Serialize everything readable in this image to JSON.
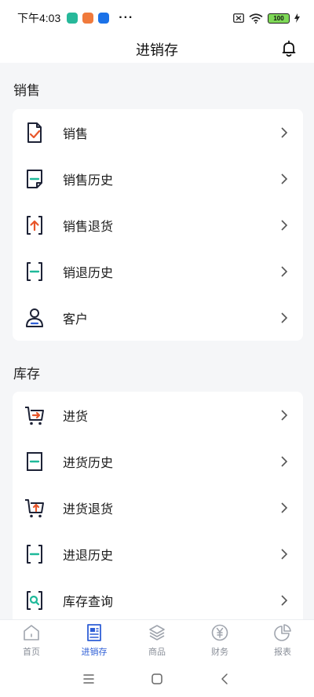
{
  "status": {
    "time": "下午4:03",
    "more": "···",
    "battery": "100"
  },
  "header": {
    "title": "进销存"
  },
  "sections": [
    {
      "title": "销售",
      "items": [
        {
          "label": "销售",
          "icon": "check-document-icon"
        },
        {
          "label": "销售历史",
          "icon": "document-history-icon"
        },
        {
          "label": "销售退货",
          "icon": "return-up-icon"
        },
        {
          "label": "销退历史",
          "icon": "bracket-history-icon"
        },
        {
          "label": "客户",
          "icon": "customer-icon"
        }
      ]
    },
    {
      "title": "库存",
      "items": [
        {
          "label": "进货",
          "icon": "cart-arrow-icon"
        },
        {
          "label": "进货历史",
          "icon": "document-history-icon"
        },
        {
          "label": "进货退货",
          "icon": "cart-return-icon"
        },
        {
          "label": "进退历史",
          "icon": "bracket-history-icon"
        },
        {
          "label": "库存查询",
          "icon": "inventory-search-icon"
        }
      ]
    }
  ],
  "tabs": [
    {
      "label": "首页",
      "icon": "home-icon",
      "active": false
    },
    {
      "label": "进销存",
      "icon": "document-list-icon",
      "active": true
    },
    {
      "label": "商品",
      "icon": "layers-icon",
      "active": false
    },
    {
      "label": "财务",
      "icon": "yuan-icon",
      "active": false
    },
    {
      "label": "报表",
      "icon": "pie-chart-icon",
      "active": false
    }
  ],
  "colors": {
    "accent": "#2f5fd6",
    "orange": "#e8562a",
    "teal": "#1fb99a",
    "icon_dark": "#1d2236"
  }
}
